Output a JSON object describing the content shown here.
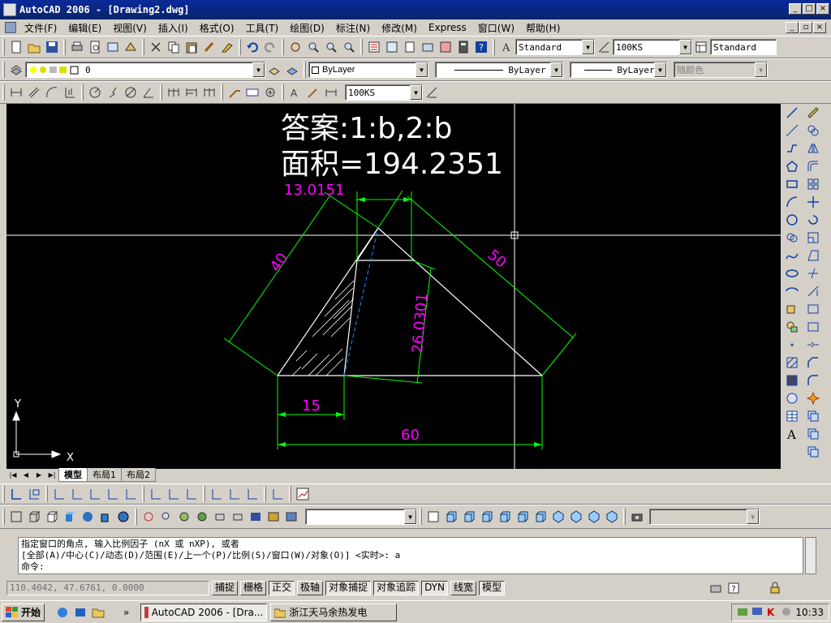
{
  "window": {
    "title": "AutoCAD 2006 - [Drawing2.dwg]",
    "buttons": [
      "_",
      "□",
      "×"
    ]
  },
  "menu": {
    "items": [
      "文件(F)",
      "编辑(E)",
      "视图(V)",
      "插入(I)",
      "格式(O)",
      "工具(T)",
      "绘图(D)",
      "标注(N)",
      "修改(M)",
      "Express",
      "窗口(W)",
      "帮助(H)"
    ]
  },
  "standard_toolbar": {
    "text_style": "Standard",
    "dim_style": "100KS",
    "table_style": "Standard"
  },
  "layers_toolbar": {
    "current_layer": "0"
  },
  "properties_toolbar": {
    "color": "ByLayer",
    "linetype": "ByLayer",
    "lineweight": "ByLayer",
    "plot_style": "随颜色"
  },
  "dim_toolbar": {
    "dim_style": "100KS"
  },
  "drawing": {
    "answer_text": "答案:1:b,2:b",
    "area_text": "面积=194.2351",
    "dims": {
      "d1": "13.0151",
      "d2": "40",
      "d3": "50",
      "d4": "26.0301",
      "d5": "15",
      "d6": "60"
    },
    "ucs_x": "X",
    "ucs_y": "Y",
    "colors": {
      "background": "#000000",
      "dimension": "#00ff00",
      "dim_text": "#ff00ff",
      "geometry": "#ffffff",
      "hidden": "#1e90ff"
    }
  },
  "layout_tabs": [
    "模型",
    "布局1",
    "布局2"
  ],
  "command": {
    "line1": "指定窗口的角点, 输入比例因子 (nX 或 nXP), 或者",
    "line2": "[全部(A)/中心(C)/动态(D)/范围(E)/上一个(P)/比例(S)/窗口(W)/对象(O)] <实时>: a",
    "prompt": "命令:"
  },
  "status": {
    "coords": "110.4042, 47.6761, 0.0000",
    "buttons": [
      "捕捉",
      "栅格",
      "正交",
      "极轴",
      "对象捕捉",
      "对象追踪",
      "DYN",
      "线宽",
      "模型"
    ]
  },
  "taskbar": {
    "start": "开始",
    "tasks": [
      "AutoCAD 2006 - [Dra...",
      "浙江天马余热发电"
    ],
    "time": "10:33"
  }
}
